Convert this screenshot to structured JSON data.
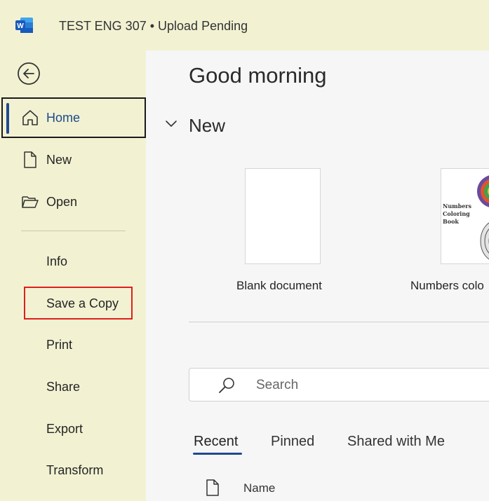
{
  "titlebar": {
    "app_icon": "word-logo-icon",
    "app_icon_letter": "W",
    "title": "TEST ENG 307 • Upload Pending"
  },
  "sidebar": {
    "back_icon": "back-arrow-icon",
    "items": [
      {
        "label": "Home",
        "icon": "home-icon",
        "selected": true
      },
      {
        "label": "New",
        "icon": "new-document-icon"
      },
      {
        "label": "Open",
        "icon": "folder-open-icon"
      }
    ],
    "secondary_items": [
      {
        "label": "Info"
      },
      {
        "label": "Save a Copy",
        "highlighted": true
      },
      {
        "label": "Print"
      },
      {
        "label": "Share"
      },
      {
        "label": "Export"
      },
      {
        "label": "Transform"
      }
    ]
  },
  "main": {
    "greeting": "Good morning",
    "new_section": {
      "heading": "New",
      "templates": [
        {
          "label": "Blank document"
        },
        {
          "label": "Numbers colo",
          "thumbnail_text": [
            "Numbers",
            "Coloring",
            "Book"
          ]
        }
      ]
    },
    "search": {
      "placeholder": "Search",
      "icon": "search-icon"
    },
    "tabs": [
      {
        "label": "Recent",
        "active": true
      },
      {
        "label": "Pinned"
      },
      {
        "label": "Shared with Me"
      }
    ],
    "file_list": {
      "columns": [
        "Name"
      ],
      "header_icon": "file-icon"
    }
  },
  "colors": {
    "sidebar_bg": "#f2f2d3",
    "main_bg": "#f6f6f6",
    "accent": "#1f4a8f",
    "highlight_box": "#e01e1e",
    "word_blue": "#185abd"
  }
}
